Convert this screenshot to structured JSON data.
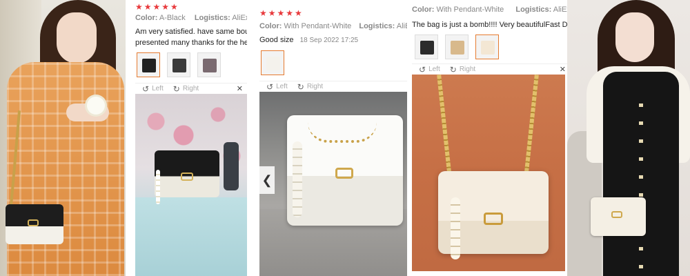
{
  "rating_symbol": "★★★★★",
  "accent_color": "#e8393c",
  "active_thumb_color": "#e57a2f",
  "viewer": {
    "left_label": "Left",
    "right_label": "Right",
    "close_symbol": "✕",
    "prev_symbol": "❮"
  },
  "reviews": [
    {
      "color_label": "Color:",
      "color_value": "A-Black",
      "logistics_label": "Logistics:",
      "logistics_value": "AliExpres",
      "comment_line1": "Am very satisfied. have same boug",
      "comment_line2": "presented many thanks for the hel"
    },
    {
      "color_label": "Color:",
      "color_value": "With Pendant-White",
      "logistics_label": "Logistics:",
      "logistics_value": "AliExpres",
      "comment_line1": "Good size",
      "date": "18 Sep 2022 17:25"
    },
    {
      "color_label": "Color:",
      "color_value": "With Pendant-White",
      "logistics_label": "Logistics:",
      "logistics_value": "AliExpre",
      "comment_line1": "The bag is just a bomb!!!! Very beautifulFast D"
    }
  ]
}
